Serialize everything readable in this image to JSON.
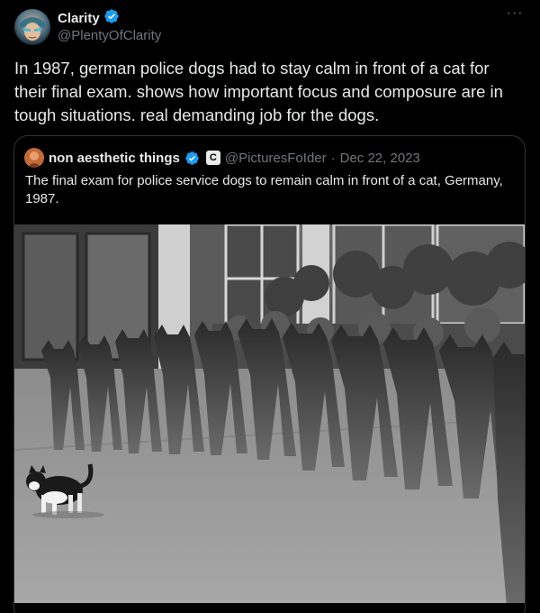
{
  "author": {
    "name": "Clarity",
    "handle": "@PlentyOfClarity",
    "verified": true
  },
  "post": {
    "text": "In 1987, german police dogs had to stay calm in front of a cat for their final exam. shows how important focus and composure are in tough situations. real demanding job for the dogs."
  },
  "more_label": "···",
  "quoted_post": {
    "name": "non aesthetic things",
    "verified": true,
    "badge_letter": "C",
    "handle": "@PicturesFoIder",
    "separator": "·",
    "date": "Dec 22, 2023",
    "text": "The final exam for police service dogs to remain calm in front of a cat, Germany, 1987."
  },
  "colors": {
    "background": "#000000",
    "text": "#e7e9ea",
    "muted": "#71767b",
    "verified_blue": "#1d9bf0",
    "border": "#2f3336"
  },
  "icons": [
    "verified-badge-icon",
    "more-dots-icon",
    "affiliate-badge-icon"
  ]
}
